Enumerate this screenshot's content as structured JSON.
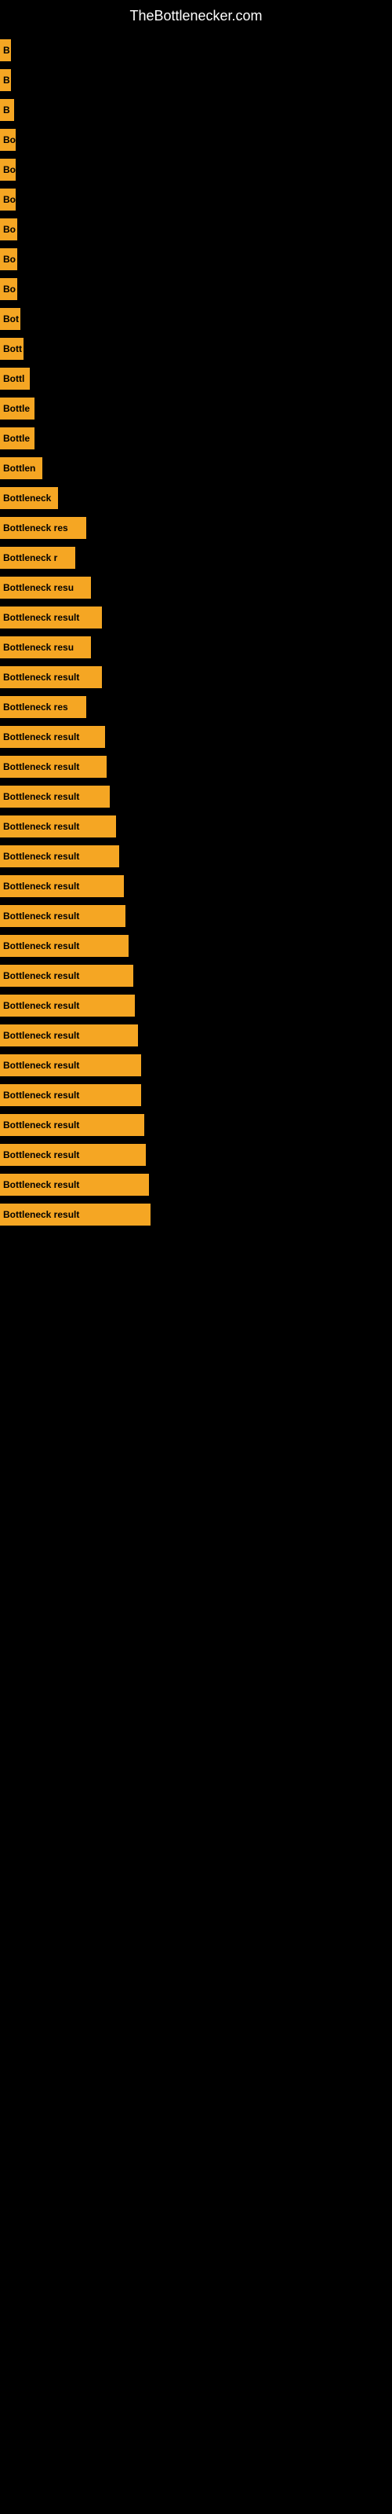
{
  "site": {
    "title": "TheBottlenecker.com"
  },
  "bars": [
    {
      "label": "B",
      "width": 14
    },
    {
      "label": "B",
      "width": 14
    },
    {
      "label": "B",
      "width": 18
    },
    {
      "label": "Bo",
      "width": 20
    },
    {
      "label": "Bo",
      "width": 20
    },
    {
      "label": "Bo",
      "width": 20
    },
    {
      "label": "Bo",
      "width": 22
    },
    {
      "label": "Bo",
      "width": 22
    },
    {
      "label": "Bo",
      "width": 22
    },
    {
      "label": "Bot",
      "width": 26
    },
    {
      "label": "Bott",
      "width": 30
    },
    {
      "label": "Bottl",
      "width": 38
    },
    {
      "label": "Bottle",
      "width": 44
    },
    {
      "label": "Bottle",
      "width": 44
    },
    {
      "label": "Bottlen",
      "width": 54
    },
    {
      "label": "Bottleneck",
      "width": 74
    },
    {
      "label": "Bottleneck res",
      "width": 110
    },
    {
      "label": "Bottleneck r",
      "width": 96
    },
    {
      "label": "Bottleneck resu",
      "width": 116
    },
    {
      "label": "Bottleneck result",
      "width": 130
    },
    {
      "label": "Bottleneck resu",
      "width": 116
    },
    {
      "label": "Bottleneck result",
      "width": 130
    },
    {
      "label": "Bottleneck res",
      "width": 110
    },
    {
      "label": "Bottleneck result",
      "width": 134
    },
    {
      "label": "Bottleneck result",
      "width": 136
    },
    {
      "label": "Bottleneck result",
      "width": 140
    },
    {
      "label": "Bottleneck result",
      "width": 148
    },
    {
      "label": "Bottleneck result",
      "width": 152
    },
    {
      "label": "Bottleneck result",
      "width": 158
    },
    {
      "label": "Bottleneck result",
      "width": 160
    },
    {
      "label": "Bottleneck result",
      "width": 164
    },
    {
      "label": "Bottleneck result",
      "width": 170
    },
    {
      "label": "Bottleneck result",
      "width": 172
    },
    {
      "label": "Bottleneck result",
      "width": 176
    },
    {
      "label": "Bottleneck result",
      "width": 180
    },
    {
      "label": "Bottleneck result",
      "width": 180
    },
    {
      "label": "Bottleneck result",
      "width": 184
    },
    {
      "label": "Bottleneck result",
      "width": 186
    },
    {
      "label": "Bottleneck result",
      "width": 190
    },
    {
      "label": "Bottleneck result",
      "width": 192
    }
  ]
}
